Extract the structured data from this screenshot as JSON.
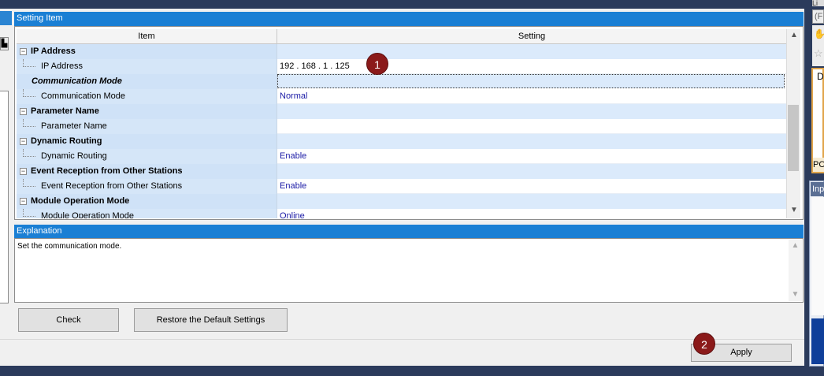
{
  "setting_item_header": "Setting Item",
  "columns": {
    "item": "Item",
    "setting": "Setting"
  },
  "rows": [
    {
      "kind": "cat",
      "label": "IP Address",
      "value": ""
    },
    {
      "kind": "sub",
      "label": "IP Address",
      "value": "192 . 168 .   1 . 125"
    },
    {
      "kind": "cat",
      "label": "Communication Mode",
      "value": ""
    },
    {
      "kind": "sub",
      "label": "Communication Mode",
      "value": "Normal"
    },
    {
      "kind": "cat",
      "label": "Parameter Name",
      "value": ""
    },
    {
      "kind": "sub",
      "label": "Parameter Name",
      "value": ""
    },
    {
      "kind": "cat",
      "label": "Dynamic Routing",
      "value": ""
    },
    {
      "kind": "sub",
      "label": "Dynamic Routing",
      "value": "Enable"
    },
    {
      "kind": "cat",
      "label": "Event Reception from Other Stations",
      "value": ""
    },
    {
      "kind": "sub",
      "label": "Event Reception from Other Stations",
      "value": "Enable"
    },
    {
      "kind": "cat",
      "label": "Module Operation Mode",
      "value": ""
    },
    {
      "kind": "sub",
      "label": "Module Operation Mode",
      "value": "Online"
    }
  ],
  "toggle_symbol": "−",
  "explanation_header": "Explanation",
  "explanation_text": "Set the communication mode.",
  "buttons": {
    "check": "Check",
    "restore": "Restore the Default Settings",
    "apply": "Apply"
  },
  "badges": {
    "one": "1",
    "two": "2"
  },
  "right_panel": {
    "top_text": "Li",
    "search_text": "(F",
    "box_letter": "D",
    "pc_label": "PC",
    "input_label": "Inp"
  },
  "left_panel": {
    "button_glyph": "▙"
  },
  "icons": {
    "scroll_up": "up-arrow-icon",
    "scroll_down": "down-arrow-icon",
    "collapse": "collapse-icon",
    "pin": "pin-icon",
    "star": "star-icon"
  },
  "colors": {
    "header_blue": "#1a7fd4",
    "category_bg": "#cfe2f7",
    "value_text": "#1a1aa6",
    "badge": "#8b1a1a"
  }
}
